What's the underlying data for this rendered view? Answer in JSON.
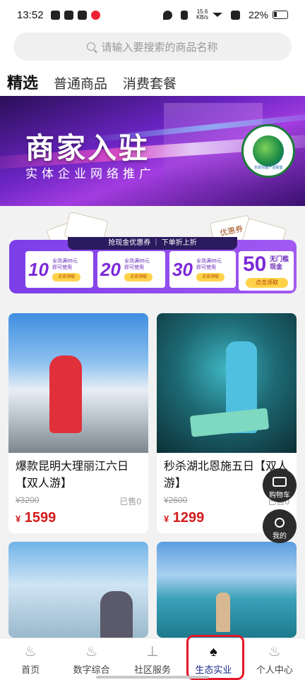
{
  "status_bar": {
    "time": "13:52",
    "net_speed": "15.6",
    "net_unit": "KB/s",
    "battery": "22%"
  },
  "search": {
    "placeholder": "请输入要搜索的商品名称"
  },
  "tabs": [
    {
      "label": "精选",
      "active": true
    },
    {
      "label": "普通商品",
      "active": false
    },
    {
      "label": "消费套餐",
      "active": false
    }
  ],
  "banner": {
    "title": "商家入驻",
    "subtitle": "实体企业网络推广",
    "badge_text": "全球30度产业联盟"
  },
  "coupons": {
    "header": "抢现金优惠券 ｜ 下单折上折",
    "deco_label": "优惠券",
    "items": [
      {
        "amount": "10",
        "line1": "全场满99元",
        "line2": "即可使用",
        "button": "点击领取"
      },
      {
        "amount": "20",
        "line1": "全场满99元",
        "line2": "即可使用",
        "button": "点击领取"
      },
      {
        "amount": "30",
        "line1": "全场满99元",
        "line2": "即可使用",
        "button": "点击领取"
      }
    ],
    "special": {
      "amount": "50",
      "line1": "无门槛",
      "line2": "现金",
      "button": "点击领取"
    }
  },
  "products": [
    {
      "title": "爆款昆明大理丽江六日【双人游】",
      "original_price": "¥3200",
      "sold": "已售0",
      "currency": "¥",
      "price": "1599"
    },
    {
      "title": "秒杀湖北恩施五日【双人游】",
      "original_price": "¥2600",
      "sold": "已售0",
      "currency": "¥",
      "price": "1299"
    },
    {
      "title": "",
      "original_price": "",
      "sold": "",
      "currency": "",
      "price": ""
    },
    {
      "title": "",
      "original_price": "",
      "sold": "",
      "currency": "",
      "price": ""
    }
  ],
  "float_buttons": {
    "cart": "购物车",
    "mine": "我的"
  },
  "bottom_nav": [
    {
      "label": "首页",
      "icon": "home-icon",
      "active": false
    },
    {
      "label": "数字综合",
      "icon": "digital-icon",
      "active": false
    },
    {
      "label": "社区服务",
      "icon": "community-icon",
      "active": false
    },
    {
      "label": "生态实业",
      "icon": "ecology-icon",
      "active": true
    },
    {
      "label": "个人中心",
      "icon": "profile-icon",
      "active": false
    }
  ],
  "colors": {
    "accent": "#7c3ee8",
    "price": "#d31a1a",
    "highlight": "#e3172a",
    "active_nav": "#1a2a8a"
  }
}
